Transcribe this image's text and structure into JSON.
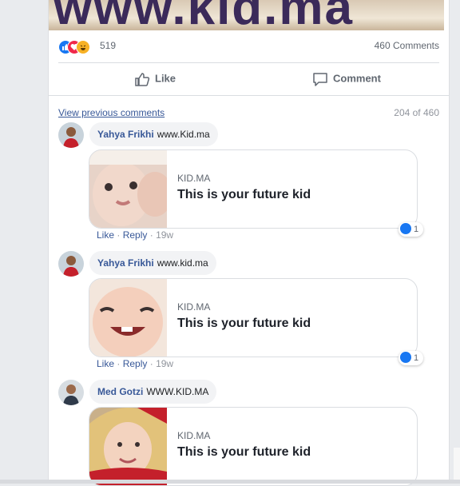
{
  "banner": {
    "text": "www.kid.ma"
  },
  "stats": {
    "reaction_count": "519",
    "comments_count": "460 Comments"
  },
  "actions": {
    "like_label": "Like",
    "comment_label": "Comment"
  },
  "comments_header": {
    "view_previous": "View previous comments",
    "pager": "204 of 460"
  },
  "comments": [
    {
      "author": "Yahya Frikhi",
      "text": "www.Kid.ma",
      "link_site": "KID.MA",
      "link_title": "This is your future kid",
      "like": "Like",
      "reply": "Reply",
      "time": "19w",
      "reaction_count": "1"
    },
    {
      "author": "Yahya Frikhi",
      "text": "www.kid.ma",
      "link_site": "KID.MA",
      "link_title": "This is your future kid",
      "like": "Like",
      "reply": "Reply",
      "time": "19w",
      "reaction_count": "1"
    },
    {
      "author": "Med Gotzi",
      "text": "WWW.KID.MA",
      "link_site": "KID.MA",
      "link_title": "This is your future kid"
    }
  ],
  "colors": {
    "accent_link": "#385898",
    "like_blue": "#1877f2",
    "love_red": "#f0284a",
    "haha_yellow": "#f7b125"
  }
}
